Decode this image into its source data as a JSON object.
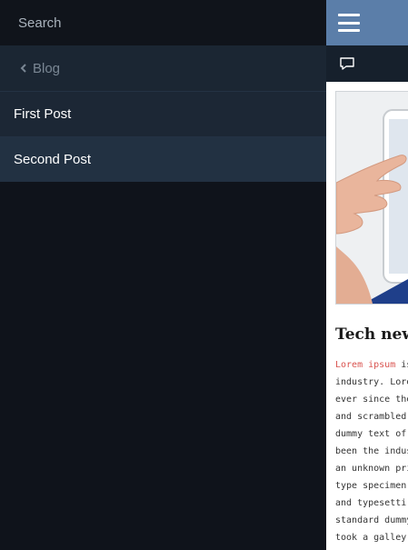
{
  "drawer": {
    "search_placeholder": "Search",
    "back_label": "Blog",
    "items": [
      {
        "label": "First Post"
      },
      {
        "label": "Second Post"
      }
    ]
  },
  "content": {
    "topbar_color": "#5b7ea9",
    "post": {
      "title": "Tech new",
      "body_lead": "Lorem ipsum",
      "body_lines": [
        " is",
        "industry. Lore",
        "ever since the",
        "and scrambled",
        "dummy text of",
        "been the indus",
        "an unknown pri",
        "type specimen",
        "and typesetti",
        "standard dummy",
        "took a galley"
      ]
    }
  }
}
